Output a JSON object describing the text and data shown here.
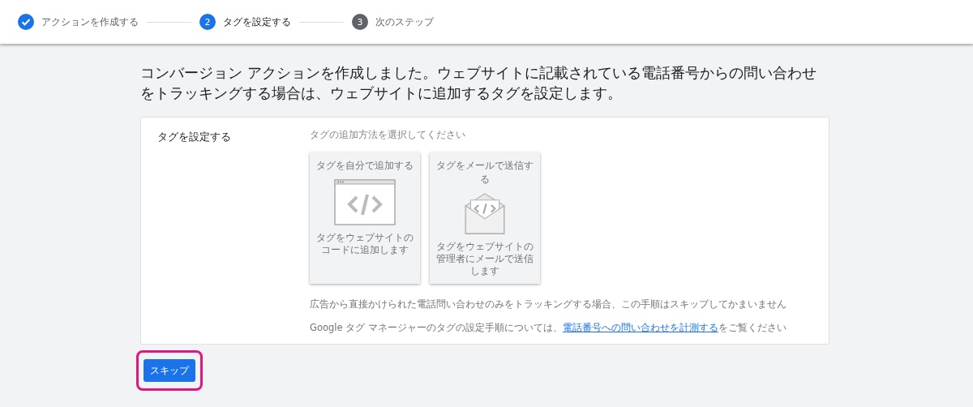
{
  "steps": [
    {
      "label": "アクションを作成する",
      "completed": true,
      "selected": false
    },
    {
      "number": "2",
      "label": "タグを設定する",
      "completed": false,
      "selected": true
    },
    {
      "number": "3",
      "label": "次のステップ",
      "completed": false,
      "selected": false
    }
  ],
  "heading": "コンバージョン アクションを作成しました。ウェブサイトに記載されている電話番号からの問い合わせをトラッキングする場合は、ウェブサイトに追加するタグを設定します。",
  "panel": {
    "title": "タグを設定する",
    "prompt": "タグの追加方法を選択してください",
    "options": [
      {
        "kind": "code",
        "title": "タグを自分で追加する",
        "description": "タグをウェブサイトのコードに追加します"
      },
      {
        "kind": "email",
        "title": "タグをメールで送信する",
        "description": "タグをウェブサイトの管理者にメールで送信します"
      }
    ],
    "note": "広告から直接かけられた電話問い合わせのみをトラッキングする場合、この手順はスキップしてかまいません",
    "help": {
      "before": "Google タグ マネージャーのタグの設定手順については、",
      "link": "電話番号への問い合わせを計測する",
      "after": "をご覧ください"
    }
  },
  "skip_button": {
    "label": "スキップ",
    "highlighted": true
  }
}
